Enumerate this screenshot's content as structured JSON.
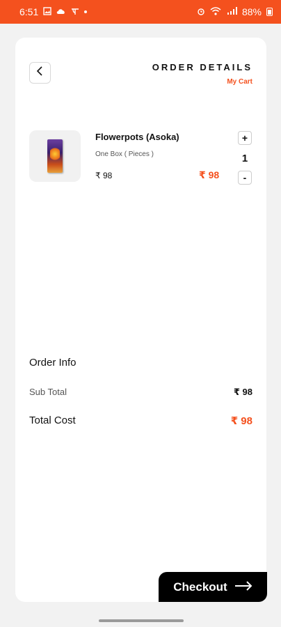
{
  "status_bar": {
    "time": "6:51",
    "battery": "88%",
    "bg_color": "#f4511e"
  },
  "header": {
    "title": "ORDER DETAILS",
    "subtitle": "My Cart",
    "back_icon": "chevron-left-icon"
  },
  "cart_items": [
    {
      "name": "Flowerpots (Asoka)",
      "unit": "One Box (  Pieces )",
      "price": "₹ 98",
      "total": "₹ 98",
      "quantity": "1",
      "plus_label": "+",
      "minus_label": "-"
    }
  ],
  "order_info": {
    "title": "Order Info",
    "subtotal_label": "Sub Total",
    "subtotal_value": "₹ 98",
    "total_label": "Total Cost",
    "total_value": "₹ 98"
  },
  "checkout": {
    "label": "Checkout",
    "arrow_icon": "arrow-right-icon"
  },
  "colors": {
    "accent": "#f4511e",
    "background": "#f2f2f2",
    "card": "#ffffff",
    "button": "#000000"
  }
}
